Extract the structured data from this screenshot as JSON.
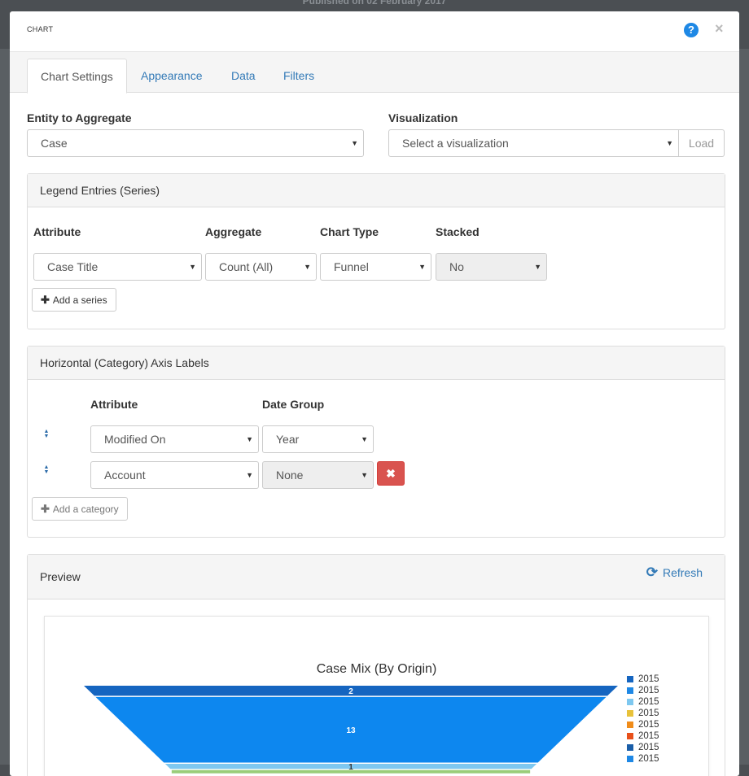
{
  "backdrop": {
    "text": "Published on 02 February 2017"
  },
  "modal": {
    "title": "CHART",
    "help_glyph": "?",
    "close_glyph": "×"
  },
  "tabs": [
    {
      "label": "Chart Settings",
      "active": true
    },
    {
      "label": "Appearance",
      "active": false
    },
    {
      "label": "Data",
      "active": false
    },
    {
      "label": "Filters",
      "active": false
    }
  ],
  "entity": {
    "label": "Entity to Aggregate",
    "value": "Case"
  },
  "visualization": {
    "label": "Visualization",
    "value": "Select a visualization",
    "load_label": "Load"
  },
  "legend_panel": {
    "heading": "Legend Entries (Series)",
    "headers": {
      "attribute": "Attribute",
      "aggregate": "Aggregate",
      "chart_type": "Chart Type",
      "stacked": "Stacked"
    },
    "row": {
      "attribute": "Case Title",
      "aggregate": "Count (All)",
      "chart_type": "Funnel",
      "stacked": "No"
    },
    "add_label": "Add a series"
  },
  "axis_panel": {
    "heading": "Horizontal (Category) Axis Labels",
    "headers": {
      "attribute": "Attribute",
      "date_group": "Date Group"
    },
    "rows": [
      {
        "attribute": "Modified On",
        "date_group": "Year"
      },
      {
        "attribute": "Account",
        "date_group": "None"
      }
    ],
    "remove_glyph": "✖",
    "add_label": "Add a category"
  },
  "preview_panel": {
    "heading": "Preview",
    "refresh_label": "Refresh"
  },
  "colors": {
    "link": "#337ab7",
    "danger": "#d9534f",
    "help": "#1e88e5"
  },
  "chart_data": {
    "type": "funnel",
    "title": "Case Mix (By Origin)",
    "segments": [
      {
        "label": "2",
        "value": 2,
        "color": "#1565c0"
      },
      {
        "label": "13",
        "value": 13,
        "color": "#0d87ef"
      },
      {
        "label": "1",
        "value": 1,
        "color": "#7ec8f0"
      }
    ],
    "legend": [
      {
        "name": "2015",
        "color": "#1565c0"
      },
      {
        "name": "2015",
        "color": "#1e88e5"
      },
      {
        "name": "2015",
        "color": "#7ec8f0"
      },
      {
        "name": "2015",
        "color": "#e8c23a"
      },
      {
        "name": "2015",
        "color": "#f08c1a"
      },
      {
        "name": "2015",
        "color": "#e8501a"
      },
      {
        "name": "2015",
        "color": "#1a5ea8"
      },
      {
        "name": "2015",
        "color": "#1e88e5"
      }
    ]
  }
}
